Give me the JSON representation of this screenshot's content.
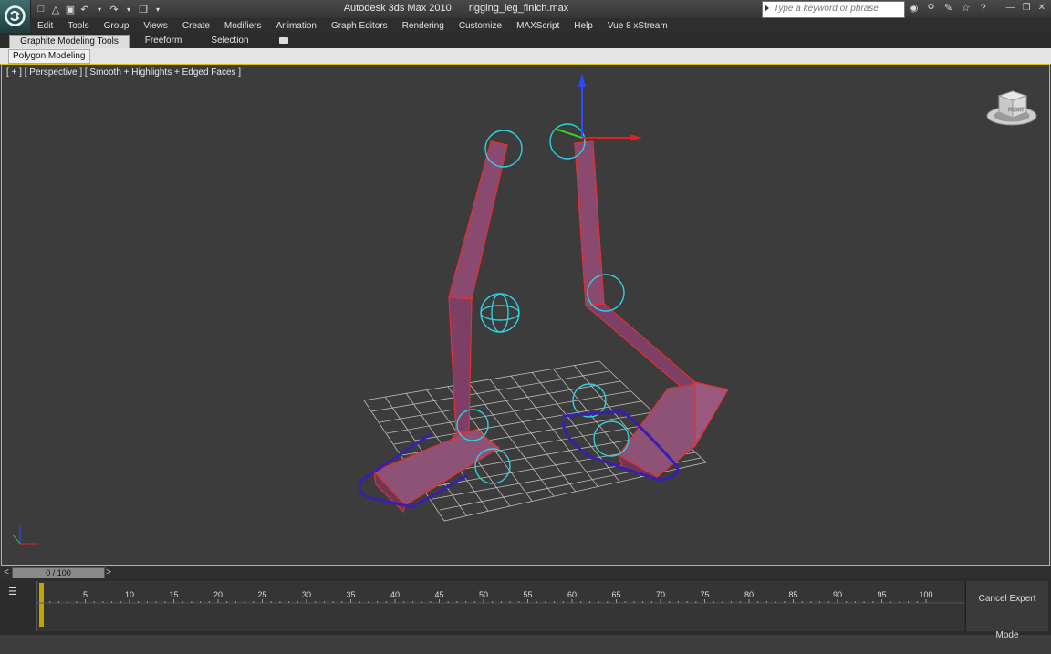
{
  "window": {
    "app_title": "Autodesk 3ds Max  2010",
    "file_name": "rigging_leg_finich.max",
    "search_placeholder": "Type a keyword or phrase"
  },
  "quick_access": {
    "icons": [
      "new-file-icon",
      "open-file-icon",
      "save-icon",
      "undo-icon",
      "redo-icon",
      "project-folder-icon"
    ]
  },
  "info_center": {
    "icons": [
      "search-binoculars-icon",
      "key-icon",
      "subscription-icon",
      "favorite-star-icon",
      "help-icon"
    ]
  },
  "menu": {
    "items": [
      "Edit",
      "Tools",
      "Group",
      "Views",
      "Create",
      "Modifiers",
      "Animation",
      "Graph Editors",
      "Rendering",
      "Customize",
      "MAXScript",
      "Help",
      "Vue 8 xStream"
    ]
  },
  "ribbon": {
    "tabs": [
      "Graphite Modeling Tools",
      "Freeform",
      "Selection"
    ],
    "active_tab": "Graphite Modeling Tools",
    "panel_button": "Polygon Modeling"
  },
  "viewport": {
    "label": "[ + ] [ Perspective ] [ Smooth + Highlights + Edged Faces ]",
    "viewcube_face": "FRONT",
    "active_border_color": "#d8c000",
    "background_color": "#3c3c3c"
  },
  "timeline": {
    "slider_text": "0 / 100",
    "ticks": [
      "5",
      "10",
      "15",
      "20",
      "25",
      "30",
      "35",
      "40",
      "45",
      "50",
      "55",
      "60",
      "65",
      "70",
      "75",
      "80",
      "85",
      "90",
      "95",
      "100"
    ],
    "current_frame": 0,
    "total_frames": 100
  },
  "status": {
    "expert_mode_button": "Cancel Expert Mode"
  }
}
